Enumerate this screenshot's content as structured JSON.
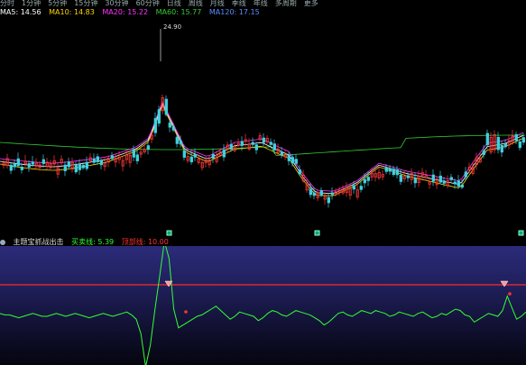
{
  "menu": [
    "分时",
    "1分钟",
    "5分钟",
    "15分钟",
    "30分钟",
    "60分钟",
    "日线",
    "周线",
    "月线",
    "季线",
    "年线",
    "多周期",
    "更多"
  ],
  "main_indicators": {
    "ma5": "MA5: 14.56",
    "ma10": "MA10: 14.83",
    "ma20": "MA20: 15.22",
    "ma60": "MA60: 15.77",
    "ma120": "MA120: 17.15"
  },
  "price_chart": {
    "peak_label": "24.90",
    "colors": {
      "up": "#ff3b3b",
      "down": "#3fd0e0",
      "ma5": "#ffffff",
      "ma10": "#ffd400",
      "ma20": "#ff33ff",
      "ma60": "#33cc33",
      "ma120": "#2266ff"
    }
  },
  "sub_indicator": {
    "name": "主题宝抓战出击",
    "label1": "买卖线: 5.39",
    "label2": "顶部线: 10.00",
    "threshold": 10
  },
  "osc_series": [
    2,
    1,
    1,
    0,
    -1,
    0,
    1,
    2,
    1,
    0,
    0,
    1,
    2,
    1,
    0,
    1,
    2,
    1,
    0,
    -1,
    0,
    1,
    2,
    1,
    0,
    1,
    2,
    3,
    1,
    -2,
    -12,
    -35,
    -20,
    5,
    28,
    52,
    40,
    5,
    -8,
    -6,
    -4,
    -2,
    0,
    1,
    3,
    5,
    7,
    4,
    1,
    -2,
    0,
    3,
    2,
    1,
    0,
    -3,
    -1,
    2,
    4,
    3,
    1,
    0,
    2,
    4,
    3,
    2,
    1,
    -1,
    -3,
    -6,
    -4,
    -1,
    2,
    3,
    1,
    0,
    2,
    4,
    3,
    2,
    4,
    3,
    2,
    0,
    1,
    3,
    2,
    1,
    0,
    2,
    3,
    1,
    -1,
    0,
    2,
    1,
    3,
    5,
    4,
    1,
    0,
    -4,
    -2,
    0,
    2,
    1,
    0,
    4,
    14,
    6,
    -2,
    0,
    3
  ]
}
